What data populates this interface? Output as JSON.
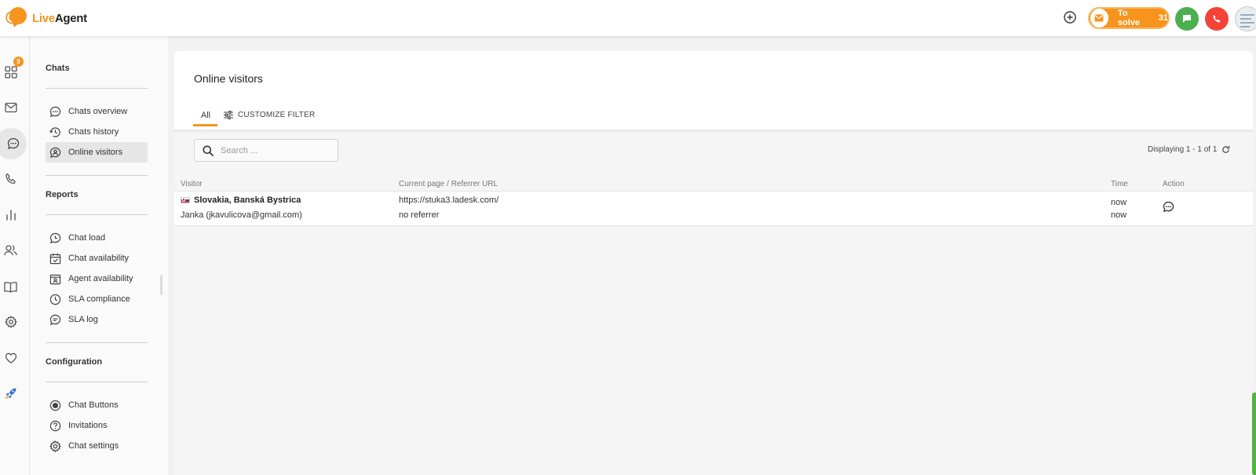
{
  "app": {
    "logo_part1": "Live",
    "logo_part2": "Agent"
  },
  "topbar": {
    "to_solve_label": "To solve",
    "to_solve_count": "31"
  },
  "rail": {
    "email_badge": "9"
  },
  "subnav": {
    "chats_title": "Chats",
    "chats_items": [
      {
        "label": "Chats overview",
        "icon": "chat-bubble-icon"
      },
      {
        "label": "Chats history",
        "icon": "history-icon"
      },
      {
        "label": "Online visitors",
        "icon": "visitor-icon",
        "active": true
      }
    ],
    "reports_title": "Reports",
    "reports_items": [
      {
        "label": "Chat load",
        "icon": "chat-load-icon"
      },
      {
        "label": "Chat availability",
        "icon": "calendar-check-icon"
      },
      {
        "label": "Agent availability",
        "icon": "agent-card-icon"
      },
      {
        "label": "SLA compliance",
        "icon": "clock-icon"
      },
      {
        "label": "SLA log",
        "icon": "sla-log-icon"
      }
    ],
    "config_title": "Configuration",
    "config_items": [
      {
        "label": "Chat Buttons",
        "icon": "chat-button-icon"
      },
      {
        "label": "Invitations",
        "icon": "question-icon"
      },
      {
        "label": "Chat settings",
        "icon": "settings-icon"
      }
    ]
  },
  "main": {
    "title": "Online visitors",
    "tab_all": "All",
    "customize_filter": "CUSTOMIZE FILTER",
    "search_placeholder": "Search ...",
    "displaying": "Displaying 1 - 1 of 1",
    "columns": {
      "visitor": "Visitor",
      "page": "Current page / Referrer URL",
      "time": "Time",
      "action": "Action"
    },
    "rows": [
      {
        "location": "Slovakia, Banská Bystrica",
        "name": "Janka (jkavulicova@gmail.com)",
        "url": "https://stuka3.ladesk.com/",
        "referrer": "no referrer",
        "time1": "now",
        "time2": "now"
      }
    ]
  },
  "colors": {
    "accent": "#f7941d",
    "chat_green": "#4caf50",
    "phone_red": "#f44336"
  }
}
